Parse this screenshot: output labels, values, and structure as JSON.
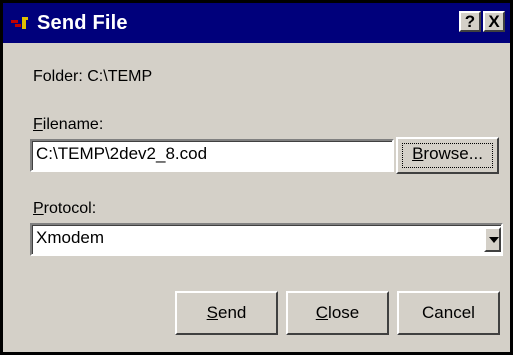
{
  "window": {
    "title": "Send File",
    "help_label": "?",
    "close_label": "X"
  },
  "folder": {
    "label": "Folder:",
    "value": "C:\\TEMP"
  },
  "filename": {
    "label_first": "F",
    "label_rest": "ilename:",
    "value": "C:\\TEMP\\2dev2_8.cod"
  },
  "browse": {
    "label_first": "B",
    "label_rest": "rowse..."
  },
  "protocol": {
    "label_first": "P",
    "label_rest": "rotocol:",
    "selected": "Xmodem"
  },
  "buttons": {
    "send_first": "S",
    "send_rest": "end",
    "close_first": "C",
    "close_rest": "lose",
    "cancel": "Cancel"
  },
  "colors": {
    "titlebar": "#00007b",
    "face": "#d4d0c8",
    "field": "#ffffff"
  }
}
